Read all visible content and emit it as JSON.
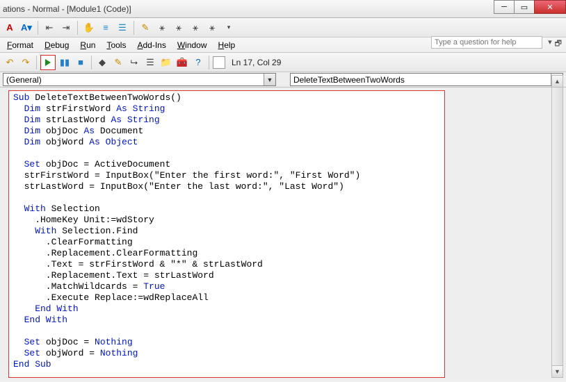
{
  "title": "ations - Normal - [Module1 (Code)]",
  "toolbar1_icons": [
    "A-red",
    "A-blue",
    "outdent",
    "indent",
    "hand",
    "lines",
    "list",
    "brush",
    "wand1",
    "wand2",
    "wand3",
    "wand4",
    "dropdown"
  ],
  "menu": {
    "format": "Format",
    "debug": "Debug",
    "run": "Run",
    "tools": "Tools",
    "addins": "Add-Ins",
    "window": "Window",
    "help": "Help"
  },
  "help_placeholder": "Type a question for help",
  "toolbar2_icons": [
    "undo",
    "redo",
    "play",
    "pause",
    "stop",
    "bookmark",
    "pencil",
    "step",
    "props",
    "folder",
    "toolbox",
    "q"
  ],
  "status": "Ln 17, Col 29",
  "status_dd_blank": "",
  "dd_left": "(General)",
  "dd_right": "DeleteTextBetweenTwoWords",
  "code": {
    "l1a": "Sub",
    "l1b": " DeleteTextBetweenTwoWords()",
    "l2a": "  Dim",
    "l2b": " strFirstWord ",
    "l2c": "As String",
    "l3a": "  Dim",
    "l3b": " strLastWord ",
    "l3c": "As String",
    "l4a": "  Dim",
    "l4b": " objDoc ",
    "l4c": "As",
    "l4d": " Document",
    "l5a": "  Dim",
    "l5b": " objWord ",
    "l5c": "As Object",
    "blank": "",
    "l7a": "  Set",
    "l7b": " objDoc = ActiveDocument",
    "l8": "  strFirstWord = InputBox(\"Enter the first word:\", \"First Word\")",
    "l9": "  strLastWord = InputBox(\"Enter the last word:\", \"Last Word\")",
    "l11a": "  With",
    "l11b": " Selection",
    "l12": "    .HomeKey Unit:=wdStory",
    "l13a": "    With",
    "l13b": " Selection.Find",
    "l14": "      .ClearFormatting",
    "l15": "      .Replacement.ClearFormatting",
    "l16": "      .Text = strFirstWord & \"*\" & strLastWord",
    "l17": "      .Replacement.Text = strLastWord",
    "l18a": "      .MatchWildcards = ",
    "l18b": "True",
    "l19": "      .Execute Replace:=wdReplaceAll",
    "l20": "    End With",
    "l21": "  End With",
    "l23a": "  Set",
    "l23b": " objDoc = ",
    "l23c": "Nothing",
    "l24a": "  Set",
    "l24b": " objWord = ",
    "l24c": "Nothing",
    "l25": "End Sub"
  }
}
